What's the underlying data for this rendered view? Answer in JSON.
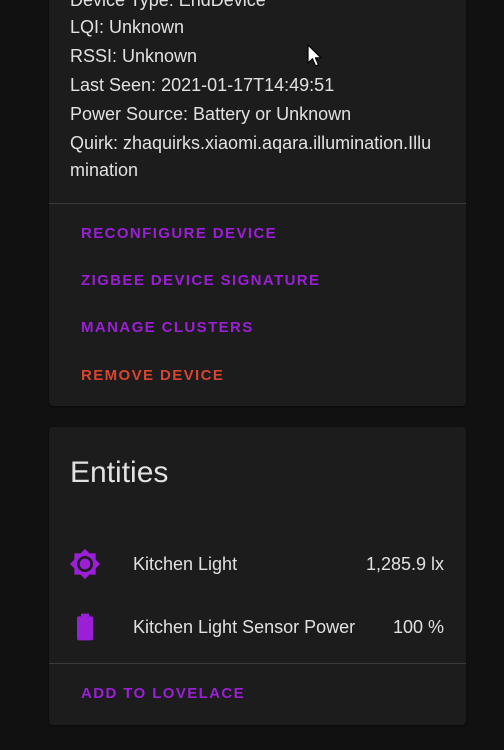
{
  "device_info": {
    "device_type": "Device Type: EndDevice",
    "lqi": "LQI: Unknown",
    "rssi": "RSSI: Unknown",
    "last_seen": "Last Seen: 2021-01-17T14:49:51",
    "power_source": "Power Source: Battery or Unknown",
    "quirk_line1": "Quirk: zhaquirks.xiaomi.aqara.illumination.Illu",
    "quirk_line2": "mination"
  },
  "device_actions": {
    "reconfigure": "RECONFIGURE DEVICE",
    "signature": "ZIGBEE DEVICE SIGNATURE",
    "clusters": "MANAGE CLUSTERS",
    "remove": "REMOVE DEVICE"
  },
  "entities": {
    "title": "Entities",
    "items": [
      {
        "name": "Kitchen Light",
        "state": "1,285.9 lx",
        "icon": "brightness-icon"
      },
      {
        "name": "Kitchen Light Sensor Power",
        "state": "100 %",
        "icon": "battery-icon"
      }
    ],
    "add_to_lovelace": "ADD TO LOVELACE"
  },
  "colors": {
    "primary": "#9b1fd6",
    "warning": "#d9442f",
    "card": "#1c1c1c",
    "background": "#111111",
    "text": "#e1e1e1"
  }
}
